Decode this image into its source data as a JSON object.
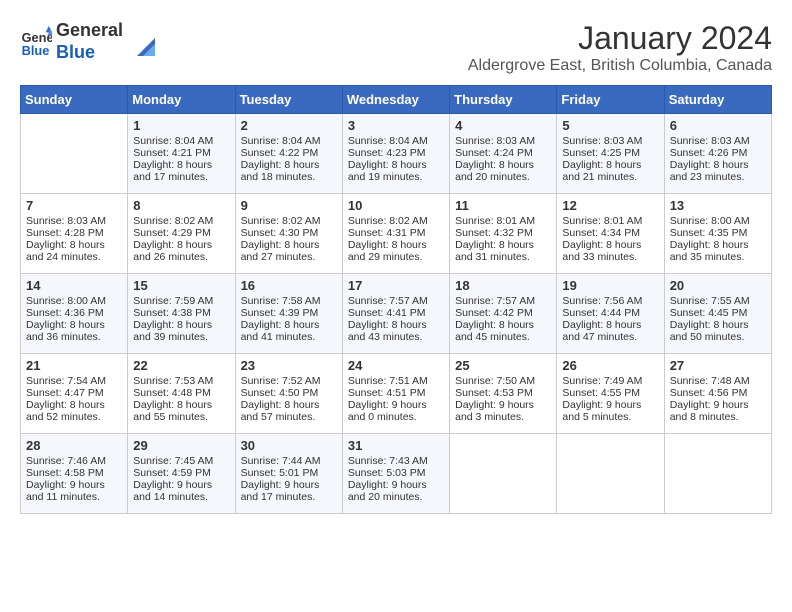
{
  "header": {
    "logo_line1": "General",
    "logo_line2": "Blue",
    "month_year": "January 2024",
    "location": "Aldergrove East, British Columbia, Canada"
  },
  "days_of_week": [
    "Sunday",
    "Monday",
    "Tuesday",
    "Wednesday",
    "Thursday",
    "Friday",
    "Saturday"
  ],
  "weeks": [
    [
      {
        "day": "",
        "sunrise": "",
        "sunset": "",
        "daylight": ""
      },
      {
        "day": "1",
        "sunrise": "Sunrise: 8:04 AM",
        "sunset": "Sunset: 4:21 PM",
        "daylight": "Daylight: 8 hours and 17 minutes."
      },
      {
        "day": "2",
        "sunrise": "Sunrise: 8:04 AM",
        "sunset": "Sunset: 4:22 PM",
        "daylight": "Daylight: 8 hours and 18 minutes."
      },
      {
        "day": "3",
        "sunrise": "Sunrise: 8:04 AM",
        "sunset": "Sunset: 4:23 PM",
        "daylight": "Daylight: 8 hours and 19 minutes."
      },
      {
        "day": "4",
        "sunrise": "Sunrise: 8:03 AM",
        "sunset": "Sunset: 4:24 PM",
        "daylight": "Daylight: 8 hours and 20 minutes."
      },
      {
        "day": "5",
        "sunrise": "Sunrise: 8:03 AM",
        "sunset": "Sunset: 4:25 PM",
        "daylight": "Daylight: 8 hours and 21 minutes."
      },
      {
        "day": "6",
        "sunrise": "Sunrise: 8:03 AM",
        "sunset": "Sunset: 4:26 PM",
        "daylight": "Daylight: 8 hours and 23 minutes."
      }
    ],
    [
      {
        "day": "7",
        "sunrise": "Sunrise: 8:03 AM",
        "sunset": "Sunset: 4:28 PM",
        "daylight": "Daylight: 8 hours and 24 minutes."
      },
      {
        "day": "8",
        "sunrise": "Sunrise: 8:02 AM",
        "sunset": "Sunset: 4:29 PM",
        "daylight": "Daylight: 8 hours and 26 minutes."
      },
      {
        "day": "9",
        "sunrise": "Sunrise: 8:02 AM",
        "sunset": "Sunset: 4:30 PM",
        "daylight": "Daylight: 8 hours and 27 minutes."
      },
      {
        "day": "10",
        "sunrise": "Sunrise: 8:02 AM",
        "sunset": "Sunset: 4:31 PM",
        "daylight": "Daylight: 8 hours and 29 minutes."
      },
      {
        "day": "11",
        "sunrise": "Sunrise: 8:01 AM",
        "sunset": "Sunset: 4:32 PM",
        "daylight": "Daylight: 8 hours and 31 minutes."
      },
      {
        "day": "12",
        "sunrise": "Sunrise: 8:01 AM",
        "sunset": "Sunset: 4:34 PM",
        "daylight": "Daylight: 8 hours and 33 minutes."
      },
      {
        "day": "13",
        "sunrise": "Sunrise: 8:00 AM",
        "sunset": "Sunset: 4:35 PM",
        "daylight": "Daylight: 8 hours and 35 minutes."
      }
    ],
    [
      {
        "day": "14",
        "sunrise": "Sunrise: 8:00 AM",
        "sunset": "Sunset: 4:36 PM",
        "daylight": "Daylight: 8 hours and 36 minutes."
      },
      {
        "day": "15",
        "sunrise": "Sunrise: 7:59 AM",
        "sunset": "Sunset: 4:38 PM",
        "daylight": "Daylight: 8 hours and 39 minutes."
      },
      {
        "day": "16",
        "sunrise": "Sunrise: 7:58 AM",
        "sunset": "Sunset: 4:39 PM",
        "daylight": "Daylight: 8 hours and 41 minutes."
      },
      {
        "day": "17",
        "sunrise": "Sunrise: 7:57 AM",
        "sunset": "Sunset: 4:41 PM",
        "daylight": "Daylight: 8 hours and 43 minutes."
      },
      {
        "day": "18",
        "sunrise": "Sunrise: 7:57 AM",
        "sunset": "Sunset: 4:42 PM",
        "daylight": "Daylight: 8 hours and 45 minutes."
      },
      {
        "day": "19",
        "sunrise": "Sunrise: 7:56 AM",
        "sunset": "Sunset: 4:44 PM",
        "daylight": "Daylight: 8 hours and 47 minutes."
      },
      {
        "day": "20",
        "sunrise": "Sunrise: 7:55 AM",
        "sunset": "Sunset: 4:45 PM",
        "daylight": "Daylight: 8 hours and 50 minutes."
      }
    ],
    [
      {
        "day": "21",
        "sunrise": "Sunrise: 7:54 AM",
        "sunset": "Sunset: 4:47 PM",
        "daylight": "Daylight: 8 hours and 52 minutes."
      },
      {
        "day": "22",
        "sunrise": "Sunrise: 7:53 AM",
        "sunset": "Sunset: 4:48 PM",
        "daylight": "Daylight: 8 hours and 55 minutes."
      },
      {
        "day": "23",
        "sunrise": "Sunrise: 7:52 AM",
        "sunset": "Sunset: 4:50 PM",
        "daylight": "Daylight: 8 hours and 57 minutes."
      },
      {
        "day": "24",
        "sunrise": "Sunrise: 7:51 AM",
        "sunset": "Sunset: 4:51 PM",
        "daylight": "Daylight: 9 hours and 0 minutes."
      },
      {
        "day": "25",
        "sunrise": "Sunrise: 7:50 AM",
        "sunset": "Sunset: 4:53 PM",
        "daylight": "Daylight: 9 hours and 3 minutes."
      },
      {
        "day": "26",
        "sunrise": "Sunrise: 7:49 AM",
        "sunset": "Sunset: 4:55 PM",
        "daylight": "Daylight: 9 hours and 5 minutes."
      },
      {
        "day": "27",
        "sunrise": "Sunrise: 7:48 AM",
        "sunset": "Sunset: 4:56 PM",
        "daylight": "Daylight: 9 hours and 8 minutes."
      }
    ],
    [
      {
        "day": "28",
        "sunrise": "Sunrise: 7:46 AM",
        "sunset": "Sunset: 4:58 PM",
        "daylight": "Daylight: 9 hours and 11 minutes."
      },
      {
        "day": "29",
        "sunrise": "Sunrise: 7:45 AM",
        "sunset": "Sunset: 4:59 PM",
        "daylight": "Daylight: 9 hours and 14 minutes."
      },
      {
        "day": "30",
        "sunrise": "Sunrise: 7:44 AM",
        "sunset": "Sunset: 5:01 PM",
        "daylight": "Daylight: 9 hours and 17 minutes."
      },
      {
        "day": "31",
        "sunrise": "Sunrise: 7:43 AM",
        "sunset": "Sunset: 5:03 PM",
        "daylight": "Daylight: 9 hours and 20 minutes."
      },
      {
        "day": "",
        "sunrise": "",
        "sunset": "",
        "daylight": ""
      },
      {
        "day": "",
        "sunrise": "",
        "sunset": "",
        "daylight": ""
      },
      {
        "day": "",
        "sunrise": "",
        "sunset": "",
        "daylight": ""
      }
    ]
  ]
}
